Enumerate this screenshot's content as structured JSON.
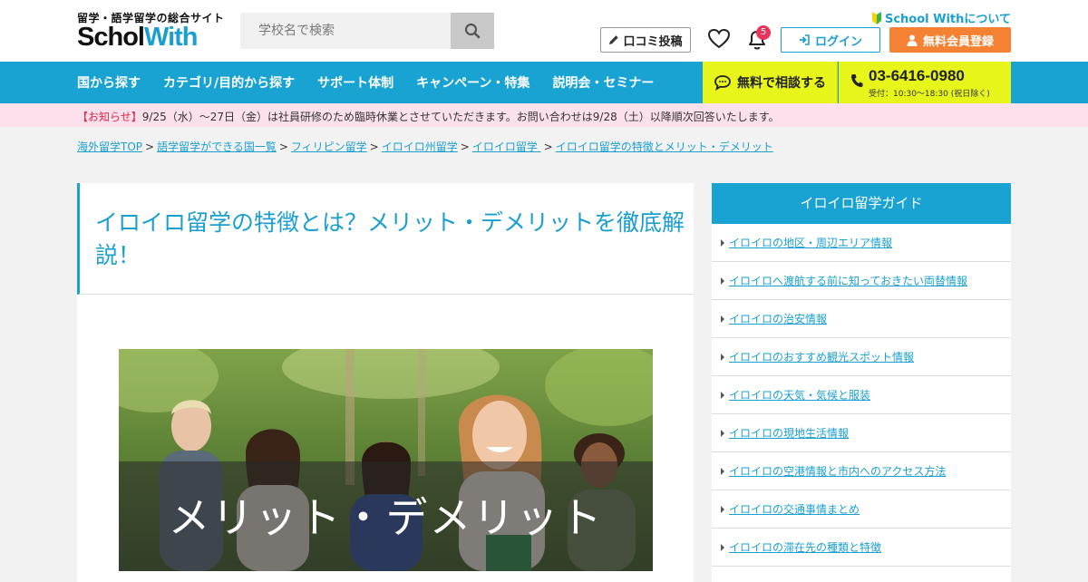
{
  "header": {
    "logo_subtitle": "留学・語学留学の総合サイト",
    "logo_school": "Sch",
    "logo_school_rest": "ol",
    "logo_with": "With",
    "search_placeholder": "学校名で検索",
    "about_label": "School Withについて",
    "review_label": "口コミ投稿",
    "notification_count": "5",
    "login_label": "ログイン",
    "signup_label": "無料会員登録",
    "colors": {
      "brand_blue": "#19a3d3",
      "orange": "#f58232",
      "yellow": "#e8f51a",
      "badge_red": "#e8335a"
    }
  },
  "nav": {
    "items": [
      "国から探す",
      "カテゴリ/目的から探す",
      "サポート体制",
      "キャンペーン・特集",
      "説明会・セミナー"
    ],
    "consult_label": "無料で相談する",
    "phone_number": "03-6416-0980",
    "phone_hours": "受付：10:30〜18:30 (祝日除く)"
  },
  "notice": {
    "tag": "【お知らせ】",
    "text": "9/25（水）〜27日（金）は社員研修のため臨時休業とさせていただきます。お問い合わせは9/28（土）以降順次回答いたします。"
  },
  "breadcrumb": [
    "海外留学TOP",
    "語学留学ができる国一覧",
    "フィリピン留学",
    "イロイロ州留学",
    "イロイロ留学 ",
    "イロイロ留学の特徴とメリット・デメリット"
  ],
  "breadcrumb_sep": ">",
  "article": {
    "title": "イロイロ留学の特徴とは？メリット・デメリットを徹底解説！",
    "hero_caption": "メリット・デメリット"
  },
  "sidebar": {
    "heading": "イロイロ留学ガイド",
    "items": [
      "イロイロの地区・周辺エリア情報",
      "イロイロへ渡航する前に知っておきたい両替情報",
      "イロイロの治安情報",
      "イロイロのおすすめ観光スポット情報",
      "イロイロの天気・気候と服装",
      "イロイロの現地生活情報",
      "イロイロの空港情報と市内へのアクセス方法",
      "イロイロの交通事情まとめ",
      "イロイロの滞在先の種類と特徴"
    ]
  }
}
